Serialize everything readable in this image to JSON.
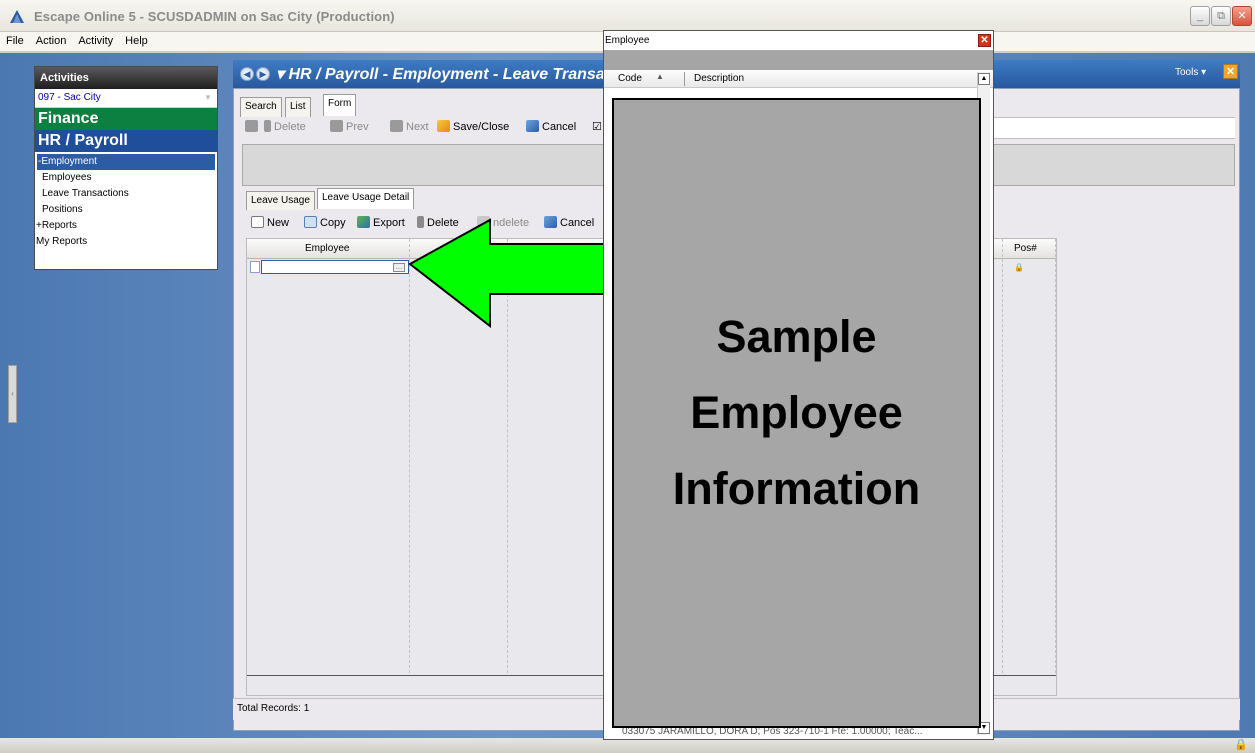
{
  "window": {
    "title": "Escape Online 5 - SCUSDADMIN on Sac City (Production)",
    "minimize": "_",
    "maximize": "⧉",
    "close": "✕"
  },
  "menu": [
    "File",
    "Action",
    "Activity",
    "Help"
  ],
  "sidebar": {
    "header": "Activities",
    "district": "097 - Sac City",
    "finance": "Finance",
    "hr": "HR / Payroll",
    "items": [
      {
        "label": "-Employment"
      },
      {
        "label": "Employees"
      },
      {
        "label": "Leave Transactions"
      },
      {
        "label": "Positions"
      },
      {
        "label": "+Reports"
      },
      {
        "label": "My Reports"
      }
    ]
  },
  "pane": {
    "breadcrumb": "▾ HR / Payroll - Employment - Leave Transa",
    "tools": "Tools ▾",
    "tools_close": "✕",
    "tabs": [
      "Search",
      "List",
      "Form"
    ],
    "toolbar": {
      "delete": "Delete",
      "prev": "Prev",
      "next": "Next",
      "save_close": "Save/Close",
      "cancel": "Cancel"
    },
    "subtabs": [
      "Leave Usage",
      "Leave Usage Detail"
    ],
    "subtoolbar": {
      "new": "New",
      "copy": "Copy",
      "export": "Export",
      "delete": "Delete",
      "undelete": "ndelete",
      "cancel": "Cancel"
    },
    "grid": {
      "col_employee": "Employee",
      "col_pos": "Pos#",
      "ellipsis": "…",
      "lock": "🔒"
    },
    "total_records": "Total Records: 1"
  },
  "popup": {
    "title": "Employee",
    "close": "✕",
    "col_code": "Code",
    "col_desc": "Description",
    "sort": "▲",
    "overlay": [
      "Sample",
      "Employee",
      "Information"
    ],
    "bottom_row": "033075     JARAMILLO, DORA D; Pos 323-710-1 Fte: 1.00000; Teac...",
    "scroll_up": "▲",
    "scroll_down": "▼"
  },
  "annotation": {
    "arrow_color": "#00ff00"
  }
}
